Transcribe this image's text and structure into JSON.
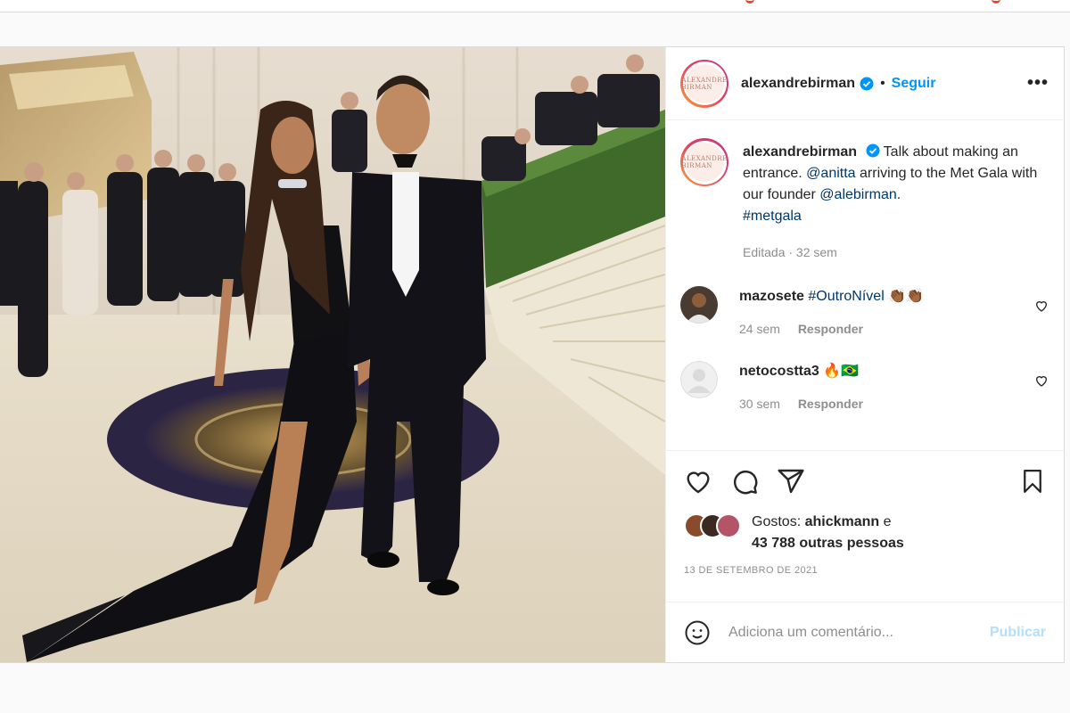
{
  "post": {
    "author": "alexandrebirman",
    "avatar_text": "ALEXANDRE BIRMAN",
    "follow_label": "Seguir",
    "separator": "•",
    "more_label": "•••",
    "caption": {
      "text_1": "Talk about making an entrance.",
      "mention_1": "@anitta",
      "text_2": "arriving to the Met Gala with our founder",
      "mention_2": "@alebirman",
      "text_3": ".",
      "hashtag": "#metgala",
      "meta": "Editada · 32 sem"
    },
    "comments": [
      {
        "user": "mazosete",
        "text": "#OutroNível",
        "emoji": "👏🏾👏🏾",
        "time": "24 sem",
        "reply_label": "Responder"
      },
      {
        "user": "netocostta3",
        "text": "",
        "emoji": "🔥🇧🇷",
        "emoji_label": "BR",
        "time": "30 sem",
        "reply_label": "Responder"
      }
    ],
    "likes": {
      "prefix": "Gostos:",
      "user": "ahickmann",
      "connector": "e",
      "count_text": "43 788 outras pessoas"
    },
    "date": "13 DE SETEMBRO DE 2021",
    "add_comment_placeholder": "Adiciona um comentário...",
    "publish_label": "Publicar"
  },
  "colors": {
    "accent": "#0095f6",
    "link": "#00376b",
    "muted": "#8e8e8e",
    "publish_disabled": "#b2dffc"
  },
  "icons": [
    "verified-badge-icon",
    "more-options-icon",
    "heart-icon",
    "comment-icon",
    "share-icon",
    "save-icon",
    "emoji-icon"
  ]
}
